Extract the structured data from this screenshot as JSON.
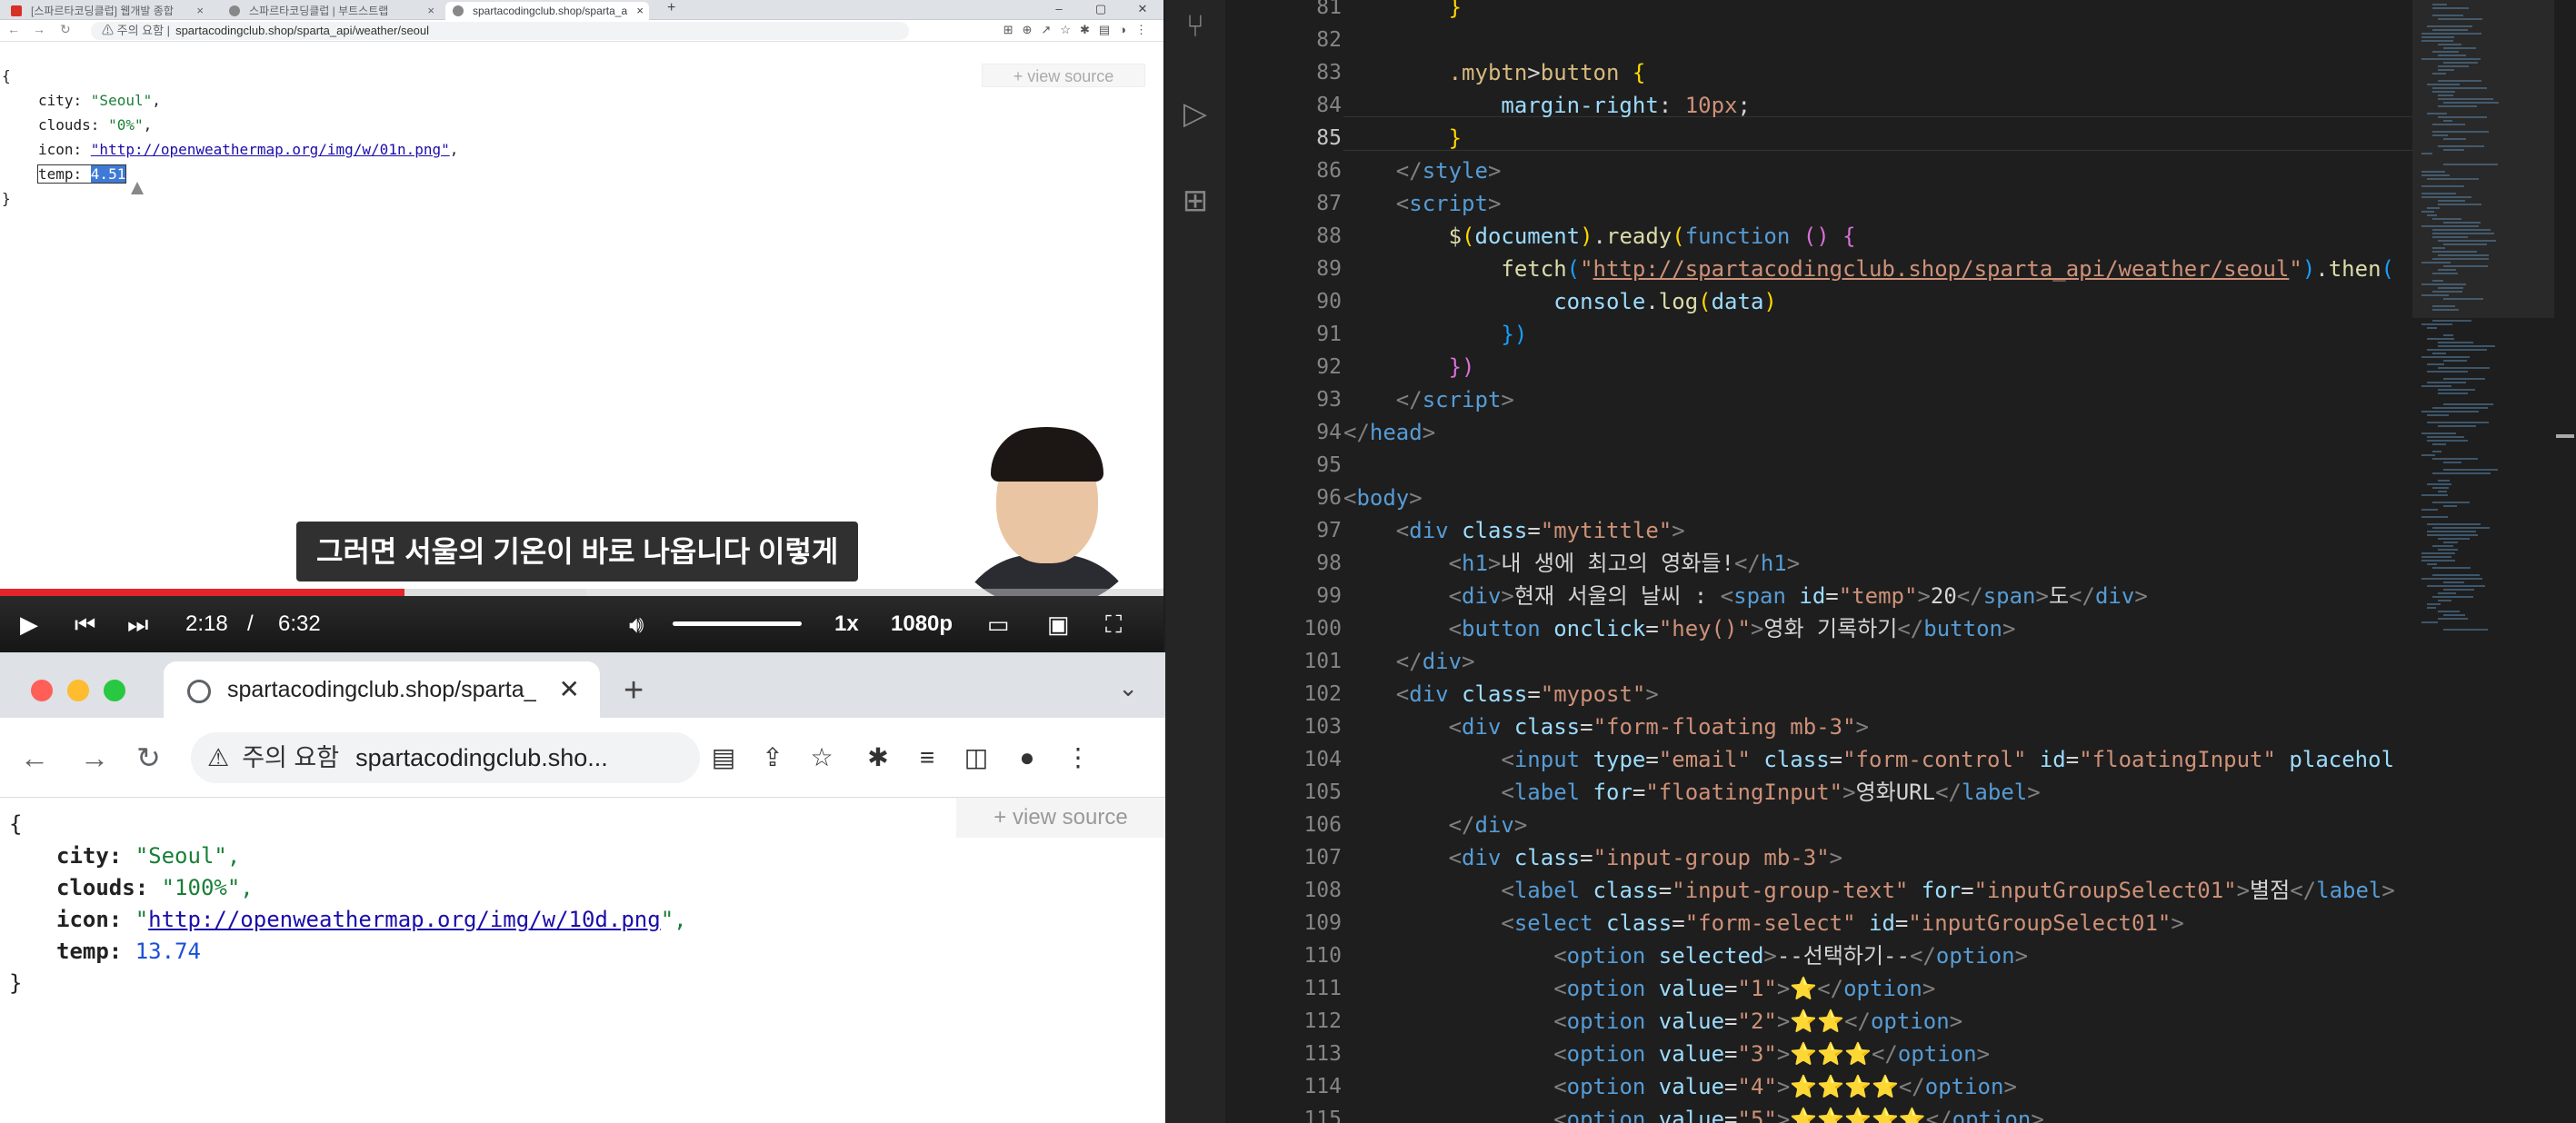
{
  "video": {
    "tabs": [
      {
        "label": "[스파르타코딩클럽] 웹개발 종합",
        "color": "#d93025"
      },
      {
        "label": "스파르타코딩클럽 | 부트스트랩",
        "color": "#5f6368"
      },
      {
        "label": "spartacodingclub.shop/sparta_a",
        "color": "#5f6368"
      }
    ],
    "new_tab": "+",
    "url_warning": "⚠ 주의 요함 |",
    "url": "spartacodingclub.shop/sparta_api/weather/seoul",
    "view_source": "+ view source",
    "json": {
      "city": "\"Seoul\"",
      "clouds": "\"0%\"",
      "icon": "\"http://openweathermap.org/img/w/01n.png\"",
      "temp": "4.51"
    },
    "subtitle": "그러면 서울의 기온이 바로 나옵니다 이렇게",
    "progress_fraction": 0.348,
    "buffered_fraction": 0.504,
    "current_time": "2:18",
    "separator": "/",
    "duration": "6:32",
    "speed": "1x",
    "quality": "1080p",
    "volume_fraction": 1.0
  },
  "browser": {
    "tab_title": "spartacodingclub.shop/sparta_",
    "url_warning": "주의 요함",
    "url": "spartacodingclub.sho...",
    "view_source": "+ view source",
    "json_open": "{",
    "json_close": "}",
    "json": {
      "city_key": "city:",
      "city": "\"Seoul\",",
      "clouds_key": "clouds:",
      "clouds": "\"100%\",",
      "icon_key": "icon:",
      "icon_q1": "\"",
      "icon": "http://openweathermap.org/img/w/10d.png",
      "icon_q2": "\",",
      "temp_key": "temp:",
      "temp": "13.74"
    },
    "traffic_lights": [
      "#ff5f57",
      "#febc2e",
      "#28c840"
    ]
  },
  "editor": {
    "current_line": "85",
    "line_numbers": [
      "81",
      "82",
      "83",
      "84",
      "85",
      "86",
      "87",
      "88",
      "89",
      "90",
      "91",
      "92",
      "93",
      "94",
      "95",
      "96",
      "97",
      "98",
      "99",
      "100",
      "101",
      "102",
      "103",
      "104",
      "105",
      "106",
      "107",
      "108",
      "109",
      "110",
      "111",
      "112",
      "113",
      "114",
      "115"
    ],
    "fetch_url": "http://spartacodingclub.shop/sparta_api/weather/seoul",
    "h1_text": "내 생에 최고의 영화들!",
    "div_text": "현재 서울의 날씨 : ",
    "span_text": "20",
    "div_tail": "도",
    "button_text": "영화 기록하기",
    "label_text": "영화URL",
    "star_label": "별점",
    "option0": "--선택하기--",
    "options": [
      "⭐",
      "⭐⭐",
      "⭐⭐⭐",
      "⭐⭐⭐⭐",
      "⭐⭐⭐⭐⭐"
    ]
  }
}
